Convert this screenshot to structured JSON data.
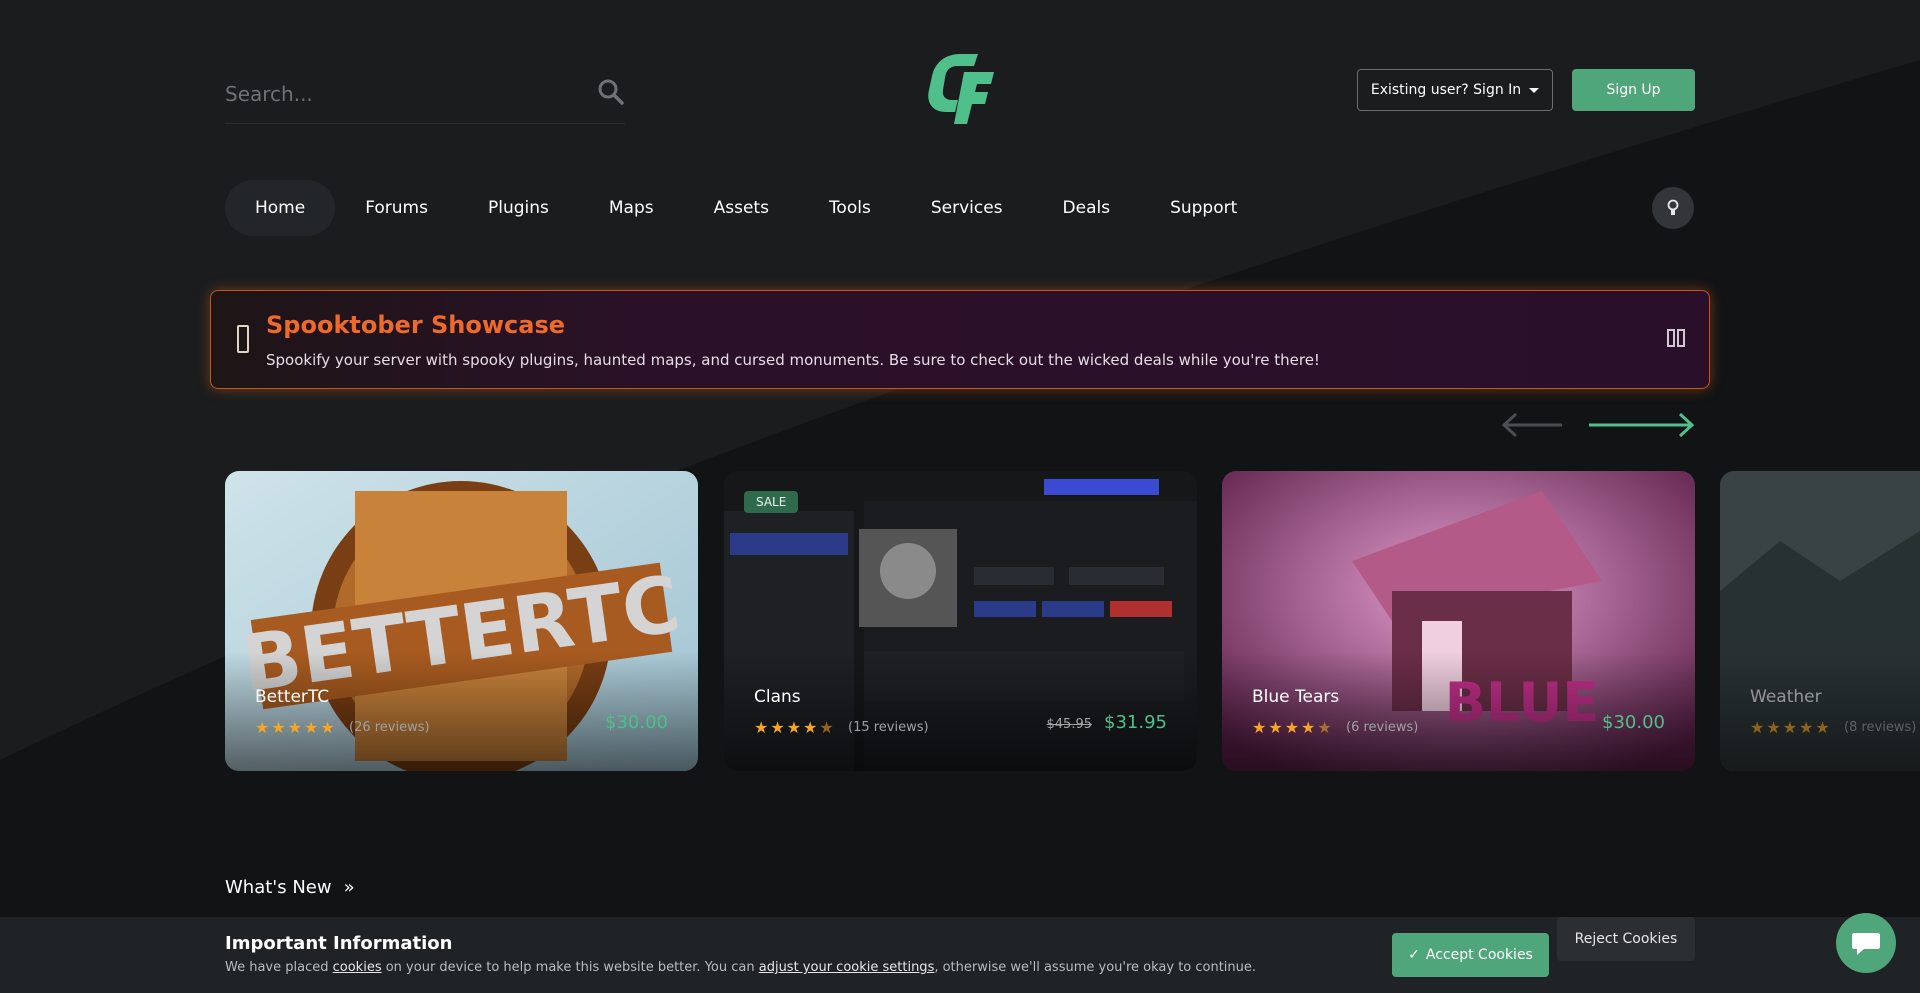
{
  "header": {
    "search": {
      "placeholder": "Search..."
    },
    "signin_label": "Existing user? Sign In",
    "signup_label": "Sign Up"
  },
  "nav": {
    "items": [
      "Home",
      "Forums",
      "Plugins",
      "Maps",
      "Assets",
      "Tools",
      "Services",
      "Deals",
      "Support"
    ],
    "active": "Home"
  },
  "banner": {
    "title": "Spooktober Showcase",
    "text": "Spookify your server with spooky plugins, haunted maps, and cursed monuments. Be sure to check out the wicked deals while you're there!"
  },
  "cards": [
    {
      "name": "BetterTC",
      "rating": 5,
      "reviews": "(26 reviews)",
      "price": "$30.00",
      "old_price": "",
      "sale": ""
    },
    {
      "name": "Clans",
      "rating": 4.5,
      "reviews": "(15 reviews)",
      "price": "$31.95",
      "old_price": "$45.95",
      "sale": "SALE"
    },
    {
      "name": "Blue Tears",
      "rating": 4.5,
      "reviews": "(6 reviews)",
      "price": "$30.00",
      "old_price": "",
      "sale": ""
    },
    {
      "name": "Weather",
      "rating": 5,
      "reviews": "(8 reviews)",
      "price": "",
      "old_price": "",
      "sale": ""
    }
  ],
  "section": {
    "whats_new": "What's New"
  },
  "cookie": {
    "title": "Important Information",
    "text_before": "We have placed ",
    "link1": "cookies",
    "text_mid": " on your device to help make this website better. You can ",
    "link2": "adjust your cookie settings",
    "text_after": ", otherwise we'll assume you're okay to continue.",
    "accept": "Accept Cookies",
    "reject": "Reject Cookies"
  },
  "colors": {
    "accent": "#4fa67a",
    "banner_title": "#ef6a2a",
    "price": "#4fbf8b",
    "star": "#f5a623"
  },
  "icons": [
    "search-icon",
    "logo-icon",
    "caret-down-icon",
    "lightbulb-icon",
    "ghost-icon",
    "pause-icon",
    "arrow-left-icon",
    "arrow-right-icon",
    "star-icon",
    "double-chevron-right-icon",
    "check-icon",
    "chat-icon"
  ]
}
